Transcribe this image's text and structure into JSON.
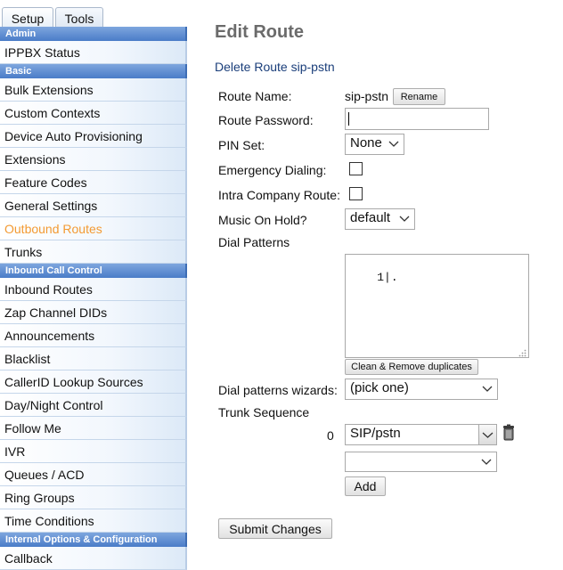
{
  "tabs": [
    {
      "label": "Setup"
    },
    {
      "label": "Tools"
    }
  ],
  "sidebar": {
    "sections": [
      {
        "header": "Admin",
        "items": [
          "IPPBX Status"
        ]
      },
      {
        "header": "Basic",
        "items": [
          "Bulk Extensions",
          "Custom Contexts",
          "Device Auto Provisioning",
          "Extensions",
          "Feature Codes",
          "General Settings",
          "Outbound Routes",
          "Trunks"
        ]
      },
      {
        "header": "Inbound Call Control",
        "items": [
          "Inbound Routes",
          "Zap Channel DIDs",
          "Announcements",
          "Blacklist",
          "CallerID Lookup Sources",
          "Day/Night Control",
          "Follow Me",
          "IVR",
          "Queues / ACD",
          "Ring Groups",
          "Time Conditions"
        ]
      },
      {
        "header": "Internal Options & Configuration",
        "items": [
          "Callback"
        ]
      }
    ],
    "active_item": "Outbound Routes"
  },
  "page": {
    "title": "Edit Route",
    "delete_link": "Delete Route sip-pstn"
  },
  "form": {
    "route_name_label": "Route Name:",
    "route_name_value": "sip-pstn",
    "rename_button": "Rename",
    "route_password_label": "Route Password:",
    "route_password_value": "",
    "pin_set_label": "PIN Set:",
    "pin_set_value": "None",
    "emergency_label": "Emergency Dialing:",
    "emergency_checked": false,
    "intra_label": "Intra Company Route:",
    "intra_checked": false,
    "moh_label": "Music On Hold?",
    "moh_value": "default",
    "dial_patterns_label": "Dial Patterns",
    "dial_patterns_value": "1|.",
    "clean_button": "Clean & Remove duplicates",
    "wizards_label": "Dial patterns wizards:",
    "wizards_value": "(pick one)",
    "trunk_seq_label": "Trunk Sequence",
    "trunk_index": "0",
    "trunk_value": "SIP/pstn",
    "trunk_new_value": "",
    "add_button": "Add",
    "submit_button": "Submit Changes"
  },
  "colors": {
    "section_header": "#4a7cc8",
    "active_item": "#f39a32",
    "title": "#6b6b6b",
    "link": "#1a3e7a"
  },
  "icons": {
    "trash": "trash-icon",
    "dropdown": "chevron-down-icon",
    "resize": "resize-grip-icon"
  }
}
